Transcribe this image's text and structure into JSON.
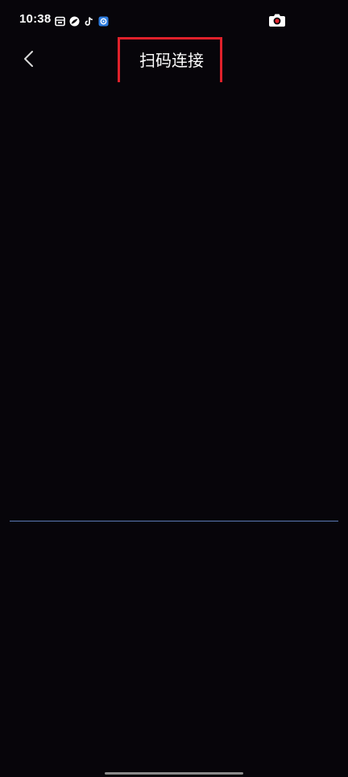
{
  "status_bar": {
    "time": "10:38",
    "notification_icons": [
      "mail-icon",
      "leaf-app-icon",
      "tiktok-icon",
      "gear-app-icon"
    ],
    "camera_indicator_icon": "camera-icon"
  },
  "nav": {
    "back_icon": "chevron-left-icon",
    "title": "扫码连接"
  },
  "colors": {
    "background": "#07050a",
    "highlight": "#e0212b",
    "scan_line": "#5a79b5"
  }
}
